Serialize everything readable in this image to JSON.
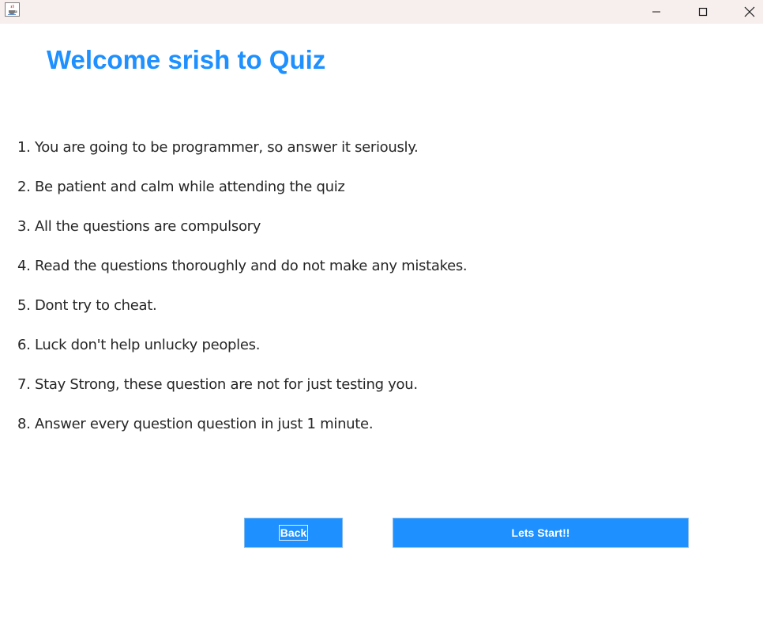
{
  "window": {
    "controls": {
      "minimize_icon": "minimize-icon",
      "maximize_icon": "maximize-icon",
      "close_icon": "close-icon"
    },
    "app_icon": "java-cup-icon"
  },
  "heading": "Welcome srish to Quiz",
  "rules": [
    "1. You are going to be programmer, so answer it seriously.",
    "2. Be patient and calm while attending the quiz",
    "3. All the questions are compulsory",
    "4. Read the questions thoroughly and do not make any mistakes.",
    "5. Dont try to cheat.",
    "6. Luck don't help unlucky peoples.",
    "7. Stay Strong, these question are not for just testing you.",
    "8. Answer every question question in just 1 minute."
  ],
  "buttons": {
    "back_label": "Back",
    "start_label": "Lets Start!!"
  },
  "colors": {
    "accent": "#1e90ff",
    "titlebar": "#f7eeee",
    "text": "#262626"
  }
}
